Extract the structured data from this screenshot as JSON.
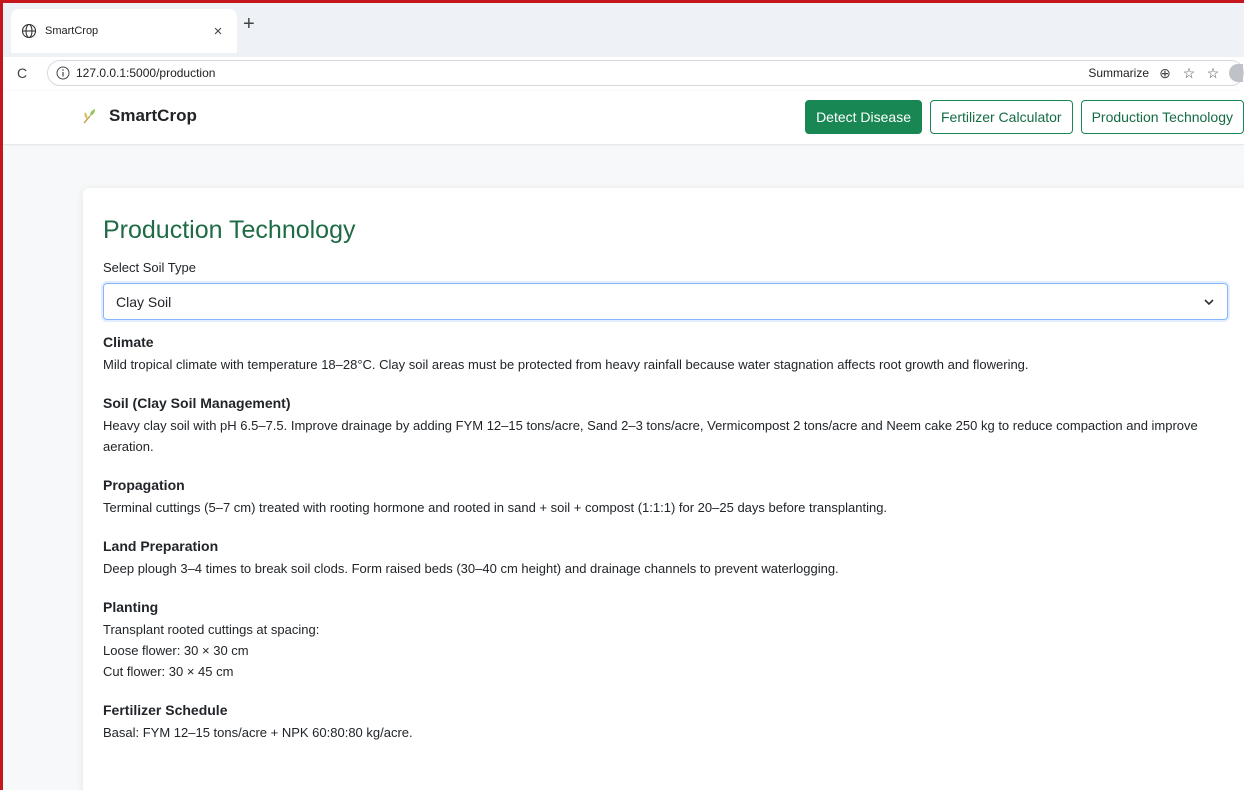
{
  "browser": {
    "tab_title": "SmartCrop",
    "tab_close": "×",
    "new_tab": "+",
    "url": "127.0.0.1:5000/production",
    "summarize": "Summarize"
  },
  "navbar": {
    "brand": "SmartCrop",
    "buttons": [
      "Detect Disease",
      "Fertilizer Calculator",
      "Production Technology"
    ]
  },
  "colors": {
    "primary_green": "#198754",
    "title_green": "#1e6b46",
    "frame_red": "#c4161c"
  },
  "main": {
    "title": "Production Technology",
    "select_label": "Select Soil Type",
    "select_value": "Clay Soil",
    "sections": [
      {
        "heading": "Climate",
        "lines": [
          "Mild tropical climate with temperature 18–28°C. Clay soil areas must be protected from heavy rainfall because water stagnation affects root growth and flowering."
        ]
      },
      {
        "heading": "Soil (Clay Soil Management)",
        "lines": [
          "Heavy clay soil with pH 6.5–7.5. Improve drainage by adding FYM 12–15 tons/acre, Sand 2–3 tons/acre, Vermicompost 2 tons/acre and Neem cake 250 kg to reduce compaction and improve aeration."
        ]
      },
      {
        "heading": "Propagation",
        "lines": [
          "Terminal cuttings (5–7 cm) treated with rooting hormone and rooted in sand + soil + compost (1:1:1) for 20–25 days before transplanting."
        ]
      },
      {
        "heading": "Land Preparation",
        "lines": [
          "Deep plough 3–4 times to break soil clods. Form raised beds (30–40 cm height) and drainage channels to prevent waterlogging."
        ]
      },
      {
        "heading": "Planting",
        "lines": [
          "Transplant rooted cuttings at spacing:",
          "Loose flower: 30 × 30 cm",
          "Cut flower: 30 × 45 cm"
        ]
      },
      {
        "heading": "Fertilizer Schedule",
        "lines": [
          "Basal: FYM 12–15 tons/acre + NPK 60:80:80 kg/acre."
        ]
      }
    ]
  }
}
